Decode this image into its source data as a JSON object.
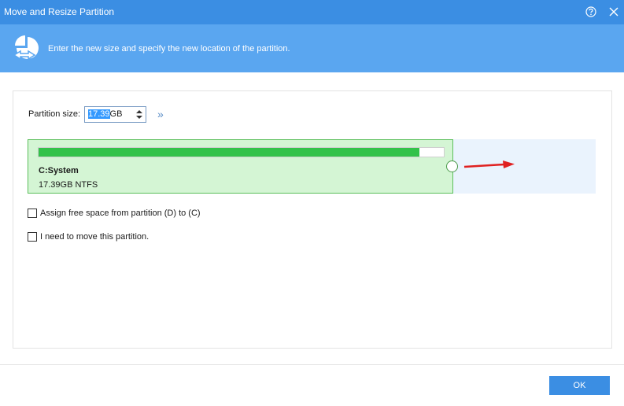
{
  "window": {
    "title": "Move and Resize Partition",
    "help_icon": "help-circle-icon",
    "close_icon": "close-icon"
  },
  "banner": {
    "icon": "partition-resize-icon",
    "text": "Enter the new size and specify the new location of the partition."
  },
  "size": {
    "label": "Partition size:",
    "value": "17.39",
    "unit": "GB",
    "expand_icon": "double-chevron-right-icon"
  },
  "partition": {
    "name": "C:System",
    "info": "17.39GB NTFS",
    "usage_fraction": 0.94
  },
  "options": [
    {
      "label": "Assign free space from partition (D) to (C)",
      "checked": false
    },
    {
      "label": "I need to move this partition.",
      "checked": false
    }
  ],
  "footer": {
    "ok_label": "OK"
  },
  "colors": {
    "titlebar": "#3b8ee3",
    "banner": "#5aa6f0",
    "partition_fill": "#d4f5d4",
    "usage_bar": "#33c24a",
    "free_space": "#eaf3fd",
    "arrow": "#e02020"
  }
}
